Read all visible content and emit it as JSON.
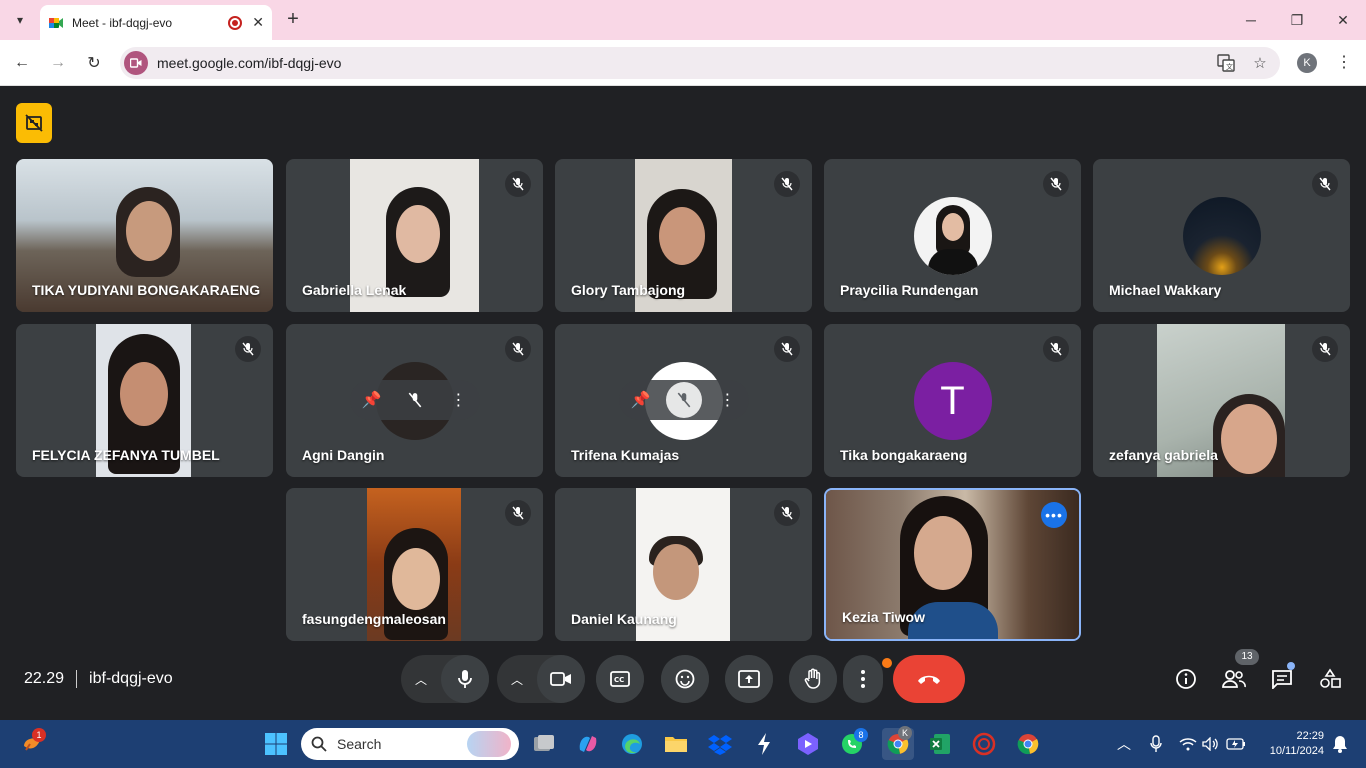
{
  "browser": {
    "tab_title": "Meet - ibf-dqgj-evo",
    "url": "meet.google.com/ibf-dqgj-evo",
    "profile_initial": "K"
  },
  "meeting": {
    "time": "22.29",
    "code": "ibf-dqgj-evo",
    "participant_count": "13"
  },
  "participants": [
    {
      "name": "TIKA YUDIYANI BONGAKARAENG"
    },
    {
      "name": "Gabriella Lenak"
    },
    {
      "name": "Glory Tambajong"
    },
    {
      "name": "Praycilia Rundengan"
    },
    {
      "name": "Michael Wakkary"
    },
    {
      "name": "FELYCIA ZEFANYA TUMBEL"
    },
    {
      "name": "Agni Dangin"
    },
    {
      "name": "Trifena Kumajas"
    },
    {
      "name": "Tika bongakaraeng",
      "avatar_letter": "T"
    },
    {
      "name": "zefanya gabriela"
    },
    {
      "name": "fasungdengmaleosan"
    },
    {
      "name": "Daniel Kaunang"
    },
    {
      "name": "Kezia Tiwow"
    }
  ],
  "taskbar": {
    "search_label": "Search",
    "time": "22:29",
    "date": "10/11/2024",
    "notif_badge": "1",
    "whatsapp_badge": "8",
    "chrome_badge": "K"
  },
  "colors": {
    "tab_bar": "#f9d7e6",
    "meet_bg": "#202124",
    "tile_bg": "#3c4043",
    "end_call": "#ea4335",
    "accent_blue": "#1a73e8",
    "avatar_purple": "#7b1fa2",
    "highlight_yellow": "#fbbc04"
  }
}
